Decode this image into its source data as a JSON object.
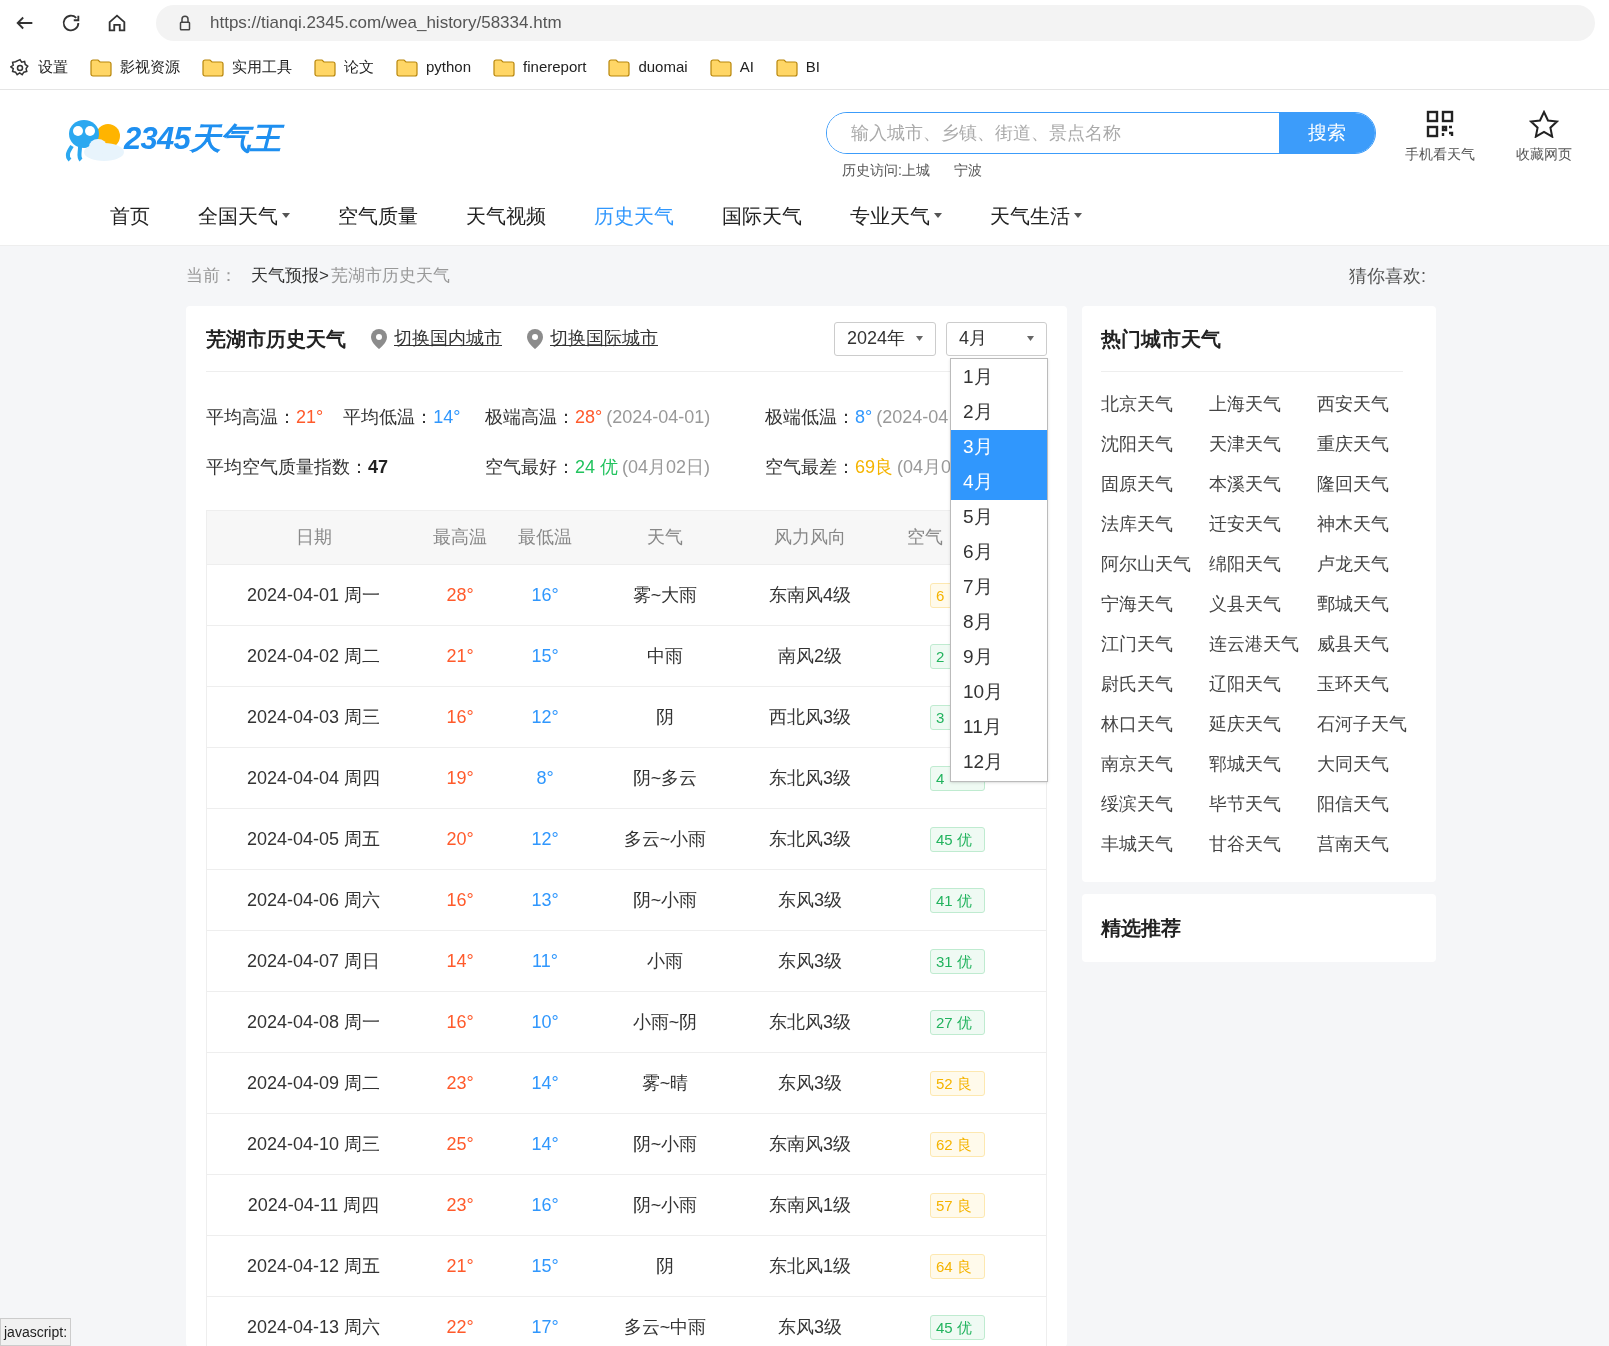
{
  "browser": {
    "url": "https://tianqi.2345.com/wea_history/58334.htm",
    "bookmarks": [
      {
        "label": "设置",
        "kind": "settings"
      },
      {
        "label": "影视资源",
        "kind": "folder"
      },
      {
        "label": "实用工具",
        "kind": "folder"
      },
      {
        "label": "论文",
        "kind": "folder"
      },
      {
        "label": "python",
        "kind": "folder"
      },
      {
        "label": "finereport",
        "kind": "folder"
      },
      {
        "label": "duomai",
        "kind": "folder"
      },
      {
        "label": "AI",
        "kind": "folder"
      },
      {
        "label": "BI",
        "kind": "folder"
      }
    ],
    "status_text": "javascript:"
  },
  "header": {
    "logo_text": "2345天气王",
    "search": {
      "placeholder": "输入城市、乡镇、街道、景点名称",
      "button": "搜索"
    },
    "history": [
      "历史访问:上城",
      "宁波"
    ],
    "tools": [
      {
        "label": "手机看天气",
        "kind": "qr"
      },
      {
        "label": "收藏网页",
        "kind": "star"
      }
    ]
  },
  "nav": [
    {
      "label": "首页",
      "selected": false,
      "dropdown": false
    },
    {
      "label": "全国天气",
      "selected": false,
      "dropdown": true
    },
    {
      "label": "空气质量",
      "selected": false,
      "dropdown": false
    },
    {
      "label": "天气视频",
      "selected": false,
      "dropdown": false
    },
    {
      "label": "历史天气",
      "selected": true,
      "dropdown": false
    },
    {
      "label": "国际天气",
      "selected": false,
      "dropdown": false
    },
    {
      "label": "专业天气",
      "selected": false,
      "dropdown": true
    },
    {
      "label": "天气生活",
      "selected": false,
      "dropdown": true
    }
  ],
  "breadcrumb": {
    "prefix": "当前：",
    "link": "天气预报>",
    "current": "芜湖市历史天气",
    "aside": "猜你喜欢:"
  },
  "history_panel": {
    "title": "芜湖市历史天气",
    "links": [
      "切换国内城市",
      "切换国际城市"
    ],
    "year": "2024年",
    "month": "4月",
    "month_options": [
      {
        "label": "1月",
        "selected": false
      },
      {
        "label": "2月",
        "selected": false
      },
      {
        "label": "3月",
        "selected": true
      },
      {
        "label": "4月",
        "selected": true
      },
      {
        "label": "5月",
        "selected": false
      },
      {
        "label": "6月",
        "selected": false
      },
      {
        "label": "7月",
        "selected": false
      },
      {
        "label": "8月",
        "selected": false
      },
      {
        "label": "9月",
        "selected": false
      },
      {
        "label": "10月",
        "selected": false
      },
      {
        "label": "11月",
        "selected": false
      },
      {
        "label": "12月",
        "selected": false
      }
    ],
    "stats": [
      {
        "groups": [
          {
            "items": [
              {
                "label": "平均高温：",
                "value": "21°",
                "kind": "hot"
              },
              {
                "label": "平均低温：",
                "value": "14°",
                "kind": "cold"
              }
            ]
          },
          {
            "items": [
              {
                "label": "极端高温：",
                "value": "28°",
                "kind": "hot",
                "note": "(2024-04-01)"
              }
            ]
          },
          {
            "items": [
              {
                "label": "极端低温：",
                "value": "8°",
                "kind": "cold",
                "note": "(2024-04"
              }
            ]
          }
        ]
      },
      {
        "groups": [
          {
            "items": [
              {
                "label": "平均空气质量指数：",
                "value": "47",
                "kind": "bold"
              }
            ]
          },
          {
            "items": [
              {
                "label": "空气最好：",
                "value": "24 优",
                "kind": "good",
                "note": "(04月02日)"
              }
            ]
          },
          {
            "items": [
              {
                "label": "空气最差：",
                "value": "69良",
                "kind": "fair",
                "note": "(04月0"
              }
            ]
          }
        ]
      }
    ],
    "columns": [
      "日期",
      "最高温",
      "最低温",
      "天气",
      "风力风向",
      "空气"
    ],
    "rows": [
      {
        "date": "2024-04-01 周一",
        "high": "28°",
        "low": "16°",
        "weather": "雾~大雨",
        "wind": "东南风4级",
        "aqi": "6",
        "kind": "fair"
      },
      {
        "date": "2024-04-02 周二",
        "high": "21°",
        "low": "15°",
        "weather": "中雨",
        "wind": "南风2级",
        "aqi": "2",
        "kind": "good"
      },
      {
        "date": "2024-04-03 周三",
        "high": "16°",
        "low": "12°",
        "weather": "阴",
        "wind": "西北风3级",
        "aqi": "3",
        "kind": "good"
      },
      {
        "date": "2024-04-04 周四",
        "high": "19°",
        "low": "8°",
        "weather": "阴~多云",
        "wind": "东北风3级",
        "aqi": "4",
        "kind": "good"
      },
      {
        "date": "2024-04-05 周五",
        "high": "20°",
        "low": "12°",
        "weather": "多云~小雨",
        "wind": "东北风3级",
        "aqi": "45 优",
        "kind": "good"
      },
      {
        "date": "2024-04-06 周六",
        "high": "16°",
        "low": "13°",
        "weather": "阴~小雨",
        "wind": "东风3级",
        "aqi": "41 优",
        "kind": "good"
      },
      {
        "date": "2024-04-07 周日",
        "high": "14°",
        "low": "11°",
        "weather": "小雨",
        "wind": "东风3级",
        "aqi": "31 优",
        "kind": "good"
      },
      {
        "date": "2024-04-08 周一",
        "high": "16°",
        "low": "10°",
        "weather": "小雨~阴",
        "wind": "东北风3级",
        "aqi": "27 优",
        "kind": "good"
      },
      {
        "date": "2024-04-09 周二",
        "high": "23°",
        "low": "14°",
        "weather": "雾~晴",
        "wind": "东风3级",
        "aqi": "52 良",
        "kind": "fair"
      },
      {
        "date": "2024-04-10 周三",
        "high": "25°",
        "low": "14°",
        "weather": "阴~小雨",
        "wind": "东南风3级",
        "aqi": "62 良",
        "kind": "fair"
      },
      {
        "date": "2024-04-11 周四",
        "high": "23°",
        "low": "16°",
        "weather": "阴~小雨",
        "wind": "东南风1级",
        "aqi": "57 良",
        "kind": "fair"
      },
      {
        "date": "2024-04-12 周五",
        "high": "21°",
        "low": "15°",
        "weather": "阴",
        "wind": "东北风1级",
        "aqi": "64 良",
        "kind": "fair"
      },
      {
        "date": "2024-04-13 周六",
        "high": "22°",
        "low": "17°",
        "weather": "多云~中雨",
        "wind": "东风3级",
        "aqi": "45 优",
        "kind": "good"
      }
    ]
  },
  "hot_cities": {
    "title": "热门城市天气",
    "cities": [
      "北京天气",
      "上海天气",
      "西安天气",
      "沈阳天气",
      "天津天气",
      "重庆天气",
      "固原天气",
      "本溪天气",
      "隆回天气",
      "法库天气",
      "迁安天气",
      "神木天气",
      "阿尔山天气",
      "绵阳天气",
      "卢龙天气",
      "宁海天气",
      "义县天气",
      "鄄城天气",
      "江门天气",
      "连云港天气",
      "威县天气",
      "尉氏天气",
      "辽阳天气",
      "玉环天气",
      "林口天气",
      "延庆天气",
      "石河子天气",
      "南京天气",
      "郓城天气",
      "大同天气",
      "绥滨天气",
      "毕节天气",
      "阳信天气",
      "丰城天气",
      "甘谷天气",
      "莒南天气"
    ]
  },
  "featured": {
    "title": "精选推荐"
  }
}
